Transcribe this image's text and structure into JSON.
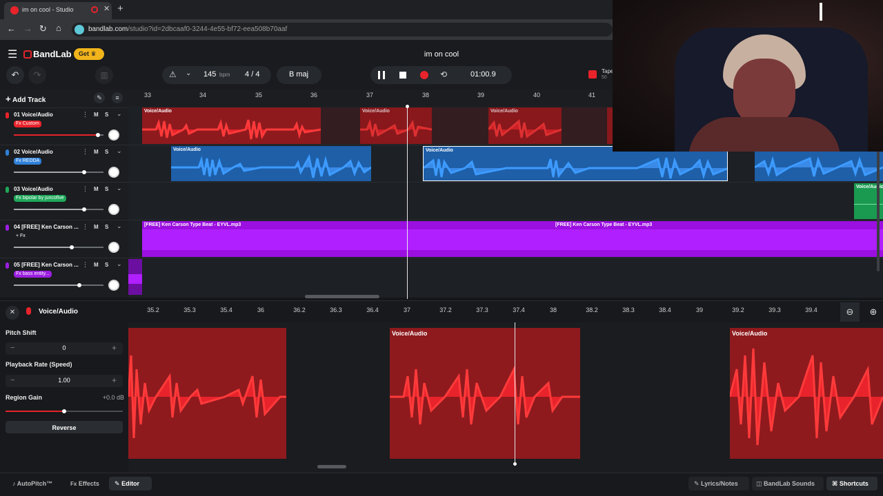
{
  "browser": {
    "tab_title": "im on cool - Studio",
    "url_domain": "bandlab.com",
    "url_path": "/studio?id=2dbcaaf0-3244-4e55-bf72-eea508b70aaf"
  },
  "app": {
    "brand": "BandLab",
    "get_label": "Get",
    "project_title": "im on cool",
    "bpm": "145",
    "bpm_unit": "bpm",
    "time_sig_num": "4",
    "time_sig_sep": "/",
    "time_sig_den": "4",
    "key": "B maj",
    "time": "01:00.9",
    "tape_label": "Tape",
    "tape_sub": "50"
  },
  "tracks_header": {
    "add_track": "Add Track"
  },
  "tracks": [
    {
      "name": "01  Voice/Audio",
      "fx": "Fx Custom",
      "fx_color": "#e8232b",
      "icon_color": "#e8232b"
    },
    {
      "name": "02  Voice/Audio",
      "fx": "Fx REDDA",
      "fx_color": "#2f80d8",
      "icon_color": "#2f80d8"
    },
    {
      "name": "03  Voice/Audio",
      "fx": "Fx bipolar by juncofive",
      "fx_color": "#1fa85a",
      "icon_color": "#1fa85a"
    },
    {
      "name": "04  [FREE] Ken Carson ...",
      "fx": "+ Fx",
      "fx_color": "transparent",
      "icon_color": "#9b1ee0"
    },
    {
      "name": "05  [FREE] Ken Carson ...",
      "fx": "Fx bass entity...",
      "fx_color": "#9b1ee0",
      "icon_color": "#9b1ee0"
    }
  ],
  "mute_label": "M",
  "solo_label": "S",
  "ruler": [
    "33",
    "34",
    "35",
    "36",
    "37",
    "38",
    "39",
    "40",
    "41"
  ],
  "regions": {
    "voice": "Voice/Audio",
    "beat": "[FREE] Ken Carson Type Beat - EYVL.mp3"
  },
  "editor": {
    "title": "Voice/Audio",
    "pitch_shift_label": "Pitch Shift",
    "pitch_shift_value": "0",
    "playback_rate_label": "Playback Rate (Speed)",
    "playback_rate_value": "1.00",
    "region_gain_label": "Region Gain",
    "region_gain_value": "+0.0 dB",
    "reverse_label": "Reverse",
    "minus": "−",
    "plus": "+",
    "ruler": [
      "35.2",
      "35.3",
      "35.4",
      "36",
      "36.2",
      "36.3",
      "36.4",
      "37",
      "37.2",
      "37.3",
      "37.4",
      "38",
      "38.2",
      "38.3",
      "38.4",
      "39",
      "39.2",
      "39.3",
      "39.4"
    ]
  },
  "bottom": {
    "autopitch": "AutoPitch™",
    "effects": "Effects",
    "editor": "Editor",
    "lyrics": "Lyrics/Notes",
    "sounds": "BandLab Sounds",
    "shortcuts": "Shortcuts"
  }
}
